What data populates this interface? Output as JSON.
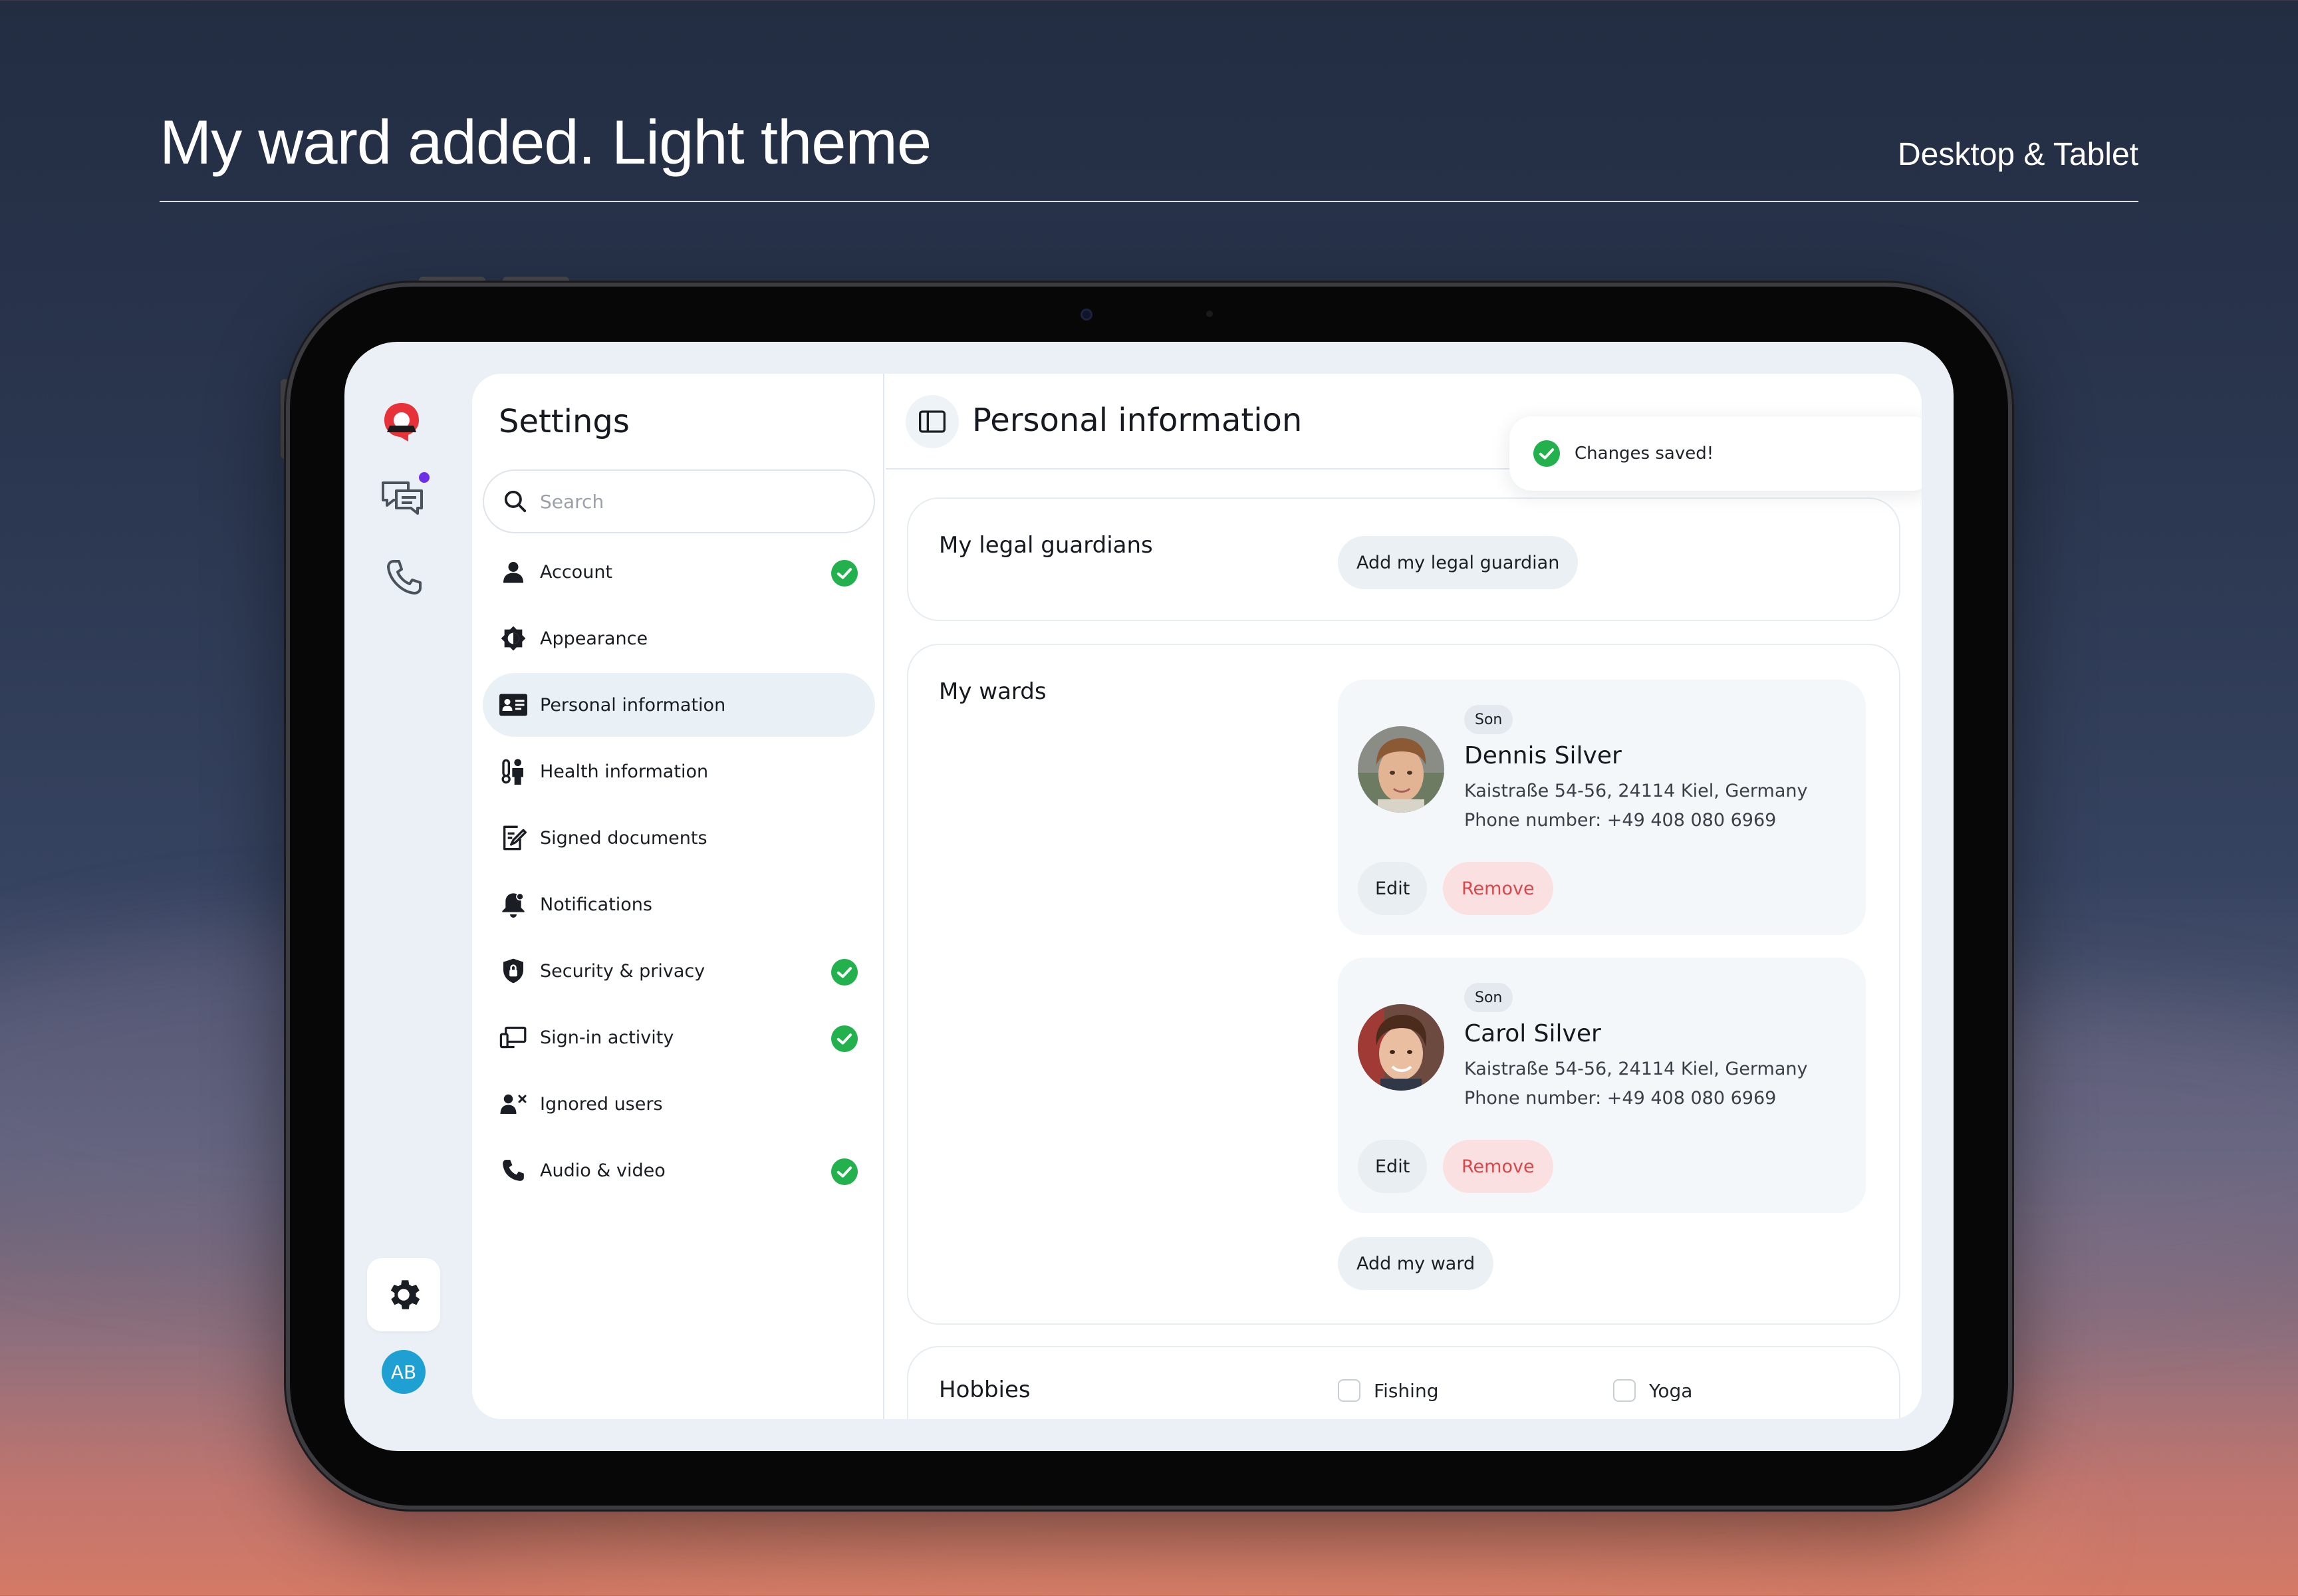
{
  "slide": {
    "title": "My ward added. Light theme",
    "subtitle": "Desktop & Tablet"
  },
  "rail": {
    "avatar_initials": "AB",
    "notification_color": "#6d2ee8",
    "logo_color": "#e8323a"
  },
  "settings": {
    "title": "Settings",
    "search_placeholder": "Search",
    "items": [
      {
        "label": "Account",
        "icon": "user-icon",
        "checked": true,
        "active": false
      },
      {
        "label": "Appearance",
        "icon": "brightness-icon",
        "checked": false,
        "active": false
      },
      {
        "label": "Personal information",
        "icon": "id-card-icon",
        "checked": false,
        "active": true
      },
      {
        "label": "Health information",
        "icon": "health-icon",
        "checked": false,
        "active": false
      },
      {
        "label": "Signed documents",
        "icon": "signed-document-icon",
        "checked": false,
        "active": false
      },
      {
        "label": "Notifications",
        "icon": "bell-icon",
        "checked": false,
        "active": false
      },
      {
        "label": "Security & privacy",
        "icon": "shield-lock-icon",
        "checked": true,
        "active": false
      },
      {
        "label": "Sign-in activity",
        "icon": "devices-icon",
        "checked": true,
        "active": false
      },
      {
        "label": "Ignored users",
        "icon": "user-x-icon",
        "checked": false,
        "active": false
      },
      {
        "label": "Audio & video",
        "icon": "phone-icon",
        "checked": true,
        "active": false
      }
    ]
  },
  "main": {
    "title": "Personal information",
    "toast": "Changes saved!",
    "guardians": {
      "label": "My legal guardians",
      "add_button": "Add my legal guardian"
    },
    "wards": {
      "label": "My wards",
      "add_button": "Add my ward",
      "list": [
        {
          "relation": "Son",
          "name": "Dennis Silver",
          "address": "Kaistraße 54-56, 24114 Kiel, Germany",
          "phone": "Phone number: +49 408 080 6969",
          "edit": "Edit",
          "remove": "Remove"
        },
        {
          "relation": "Son",
          "name": "Carol Silver",
          "address": "Kaistraße 54-56, 24114 Kiel, Germany",
          "phone": "Phone number: +49 408 080 6969",
          "edit": "Edit",
          "remove": "Remove"
        }
      ]
    },
    "hobbies": {
      "label": "Hobbies",
      "options": [
        {
          "label": "Fishing",
          "checked": false
        },
        {
          "label": "Yoga",
          "checked": false
        }
      ]
    }
  },
  "colors": {
    "success": "#22b14c",
    "danger_text": "#d8484b",
    "danger_bg": "#fbe0e1",
    "active_item_bg": "#eaf1f6"
  }
}
